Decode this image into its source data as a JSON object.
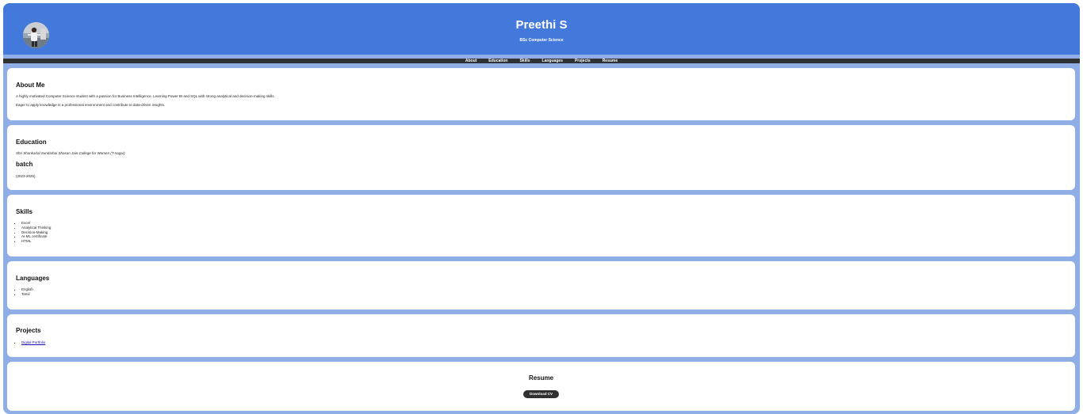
{
  "header": {
    "name": "Preethi S",
    "subtitle": "BSc Computer Science",
    "background": "#4479dc"
  },
  "nav": {
    "items": [
      "About",
      "Education",
      "Skills",
      "Languages",
      "Projects",
      "Resume"
    ]
  },
  "about": {
    "title": "About Me",
    "line1": "A highly motivated Computer Science student with a passion for Business Intelligence. Learning Power BI and SQL with strong analytical and decision-making skills.",
    "line2": "Eager to apply knowledge in a professional environment and contribute to data-driven insights."
  },
  "education": {
    "title": "Education",
    "college": "Shri Shankarlal Sundarbai Shasun Jain College for Women (T-nagar)",
    "batch_heading": "batch",
    "batch_years": "(2023-2026)"
  },
  "skills": {
    "title": "Skills",
    "items": [
      "Excel",
      "Analytical Thinking",
      "Decision-Making",
      "AI-ML certificate",
      "HTML"
    ]
  },
  "languages": {
    "title": "Languages",
    "items": [
      "English",
      "Tamil"
    ]
  },
  "projects": {
    "title": "Projects",
    "items": [
      "Digital Portfolio"
    ]
  },
  "resume": {
    "title": "Resume",
    "button_label": "Download CV"
  },
  "colors": {
    "page_background": "#8faee6",
    "nav_background": "#2f3132",
    "button": "#303030"
  }
}
